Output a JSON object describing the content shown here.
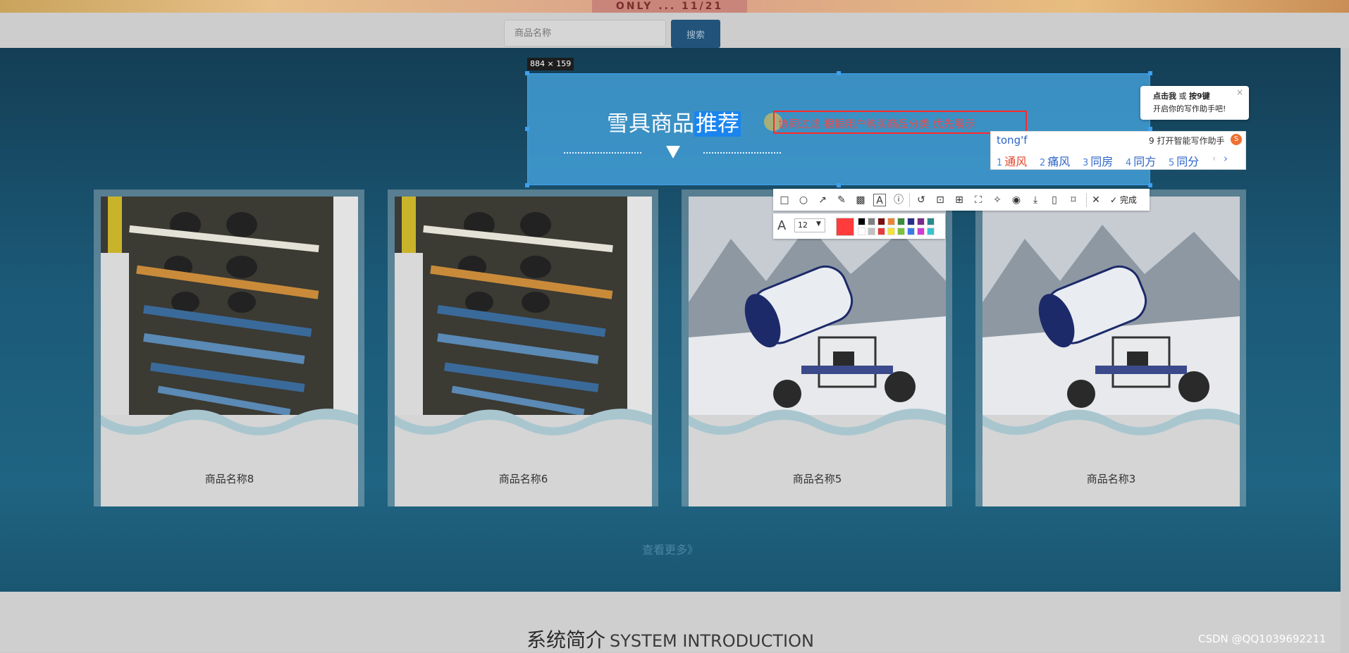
{
  "banner": {
    "text": "ONLY ... 11/21"
  },
  "search": {
    "placeholder": "商品名称",
    "button_label": "搜索"
  },
  "capture": {
    "size_label": "884 × 159",
    "title_prefix": "雪具商品",
    "title_highlight": "推荐",
    "annotation_text": "协同过滤 根据用户购买商品分类 优先展示"
  },
  "ime": {
    "tip_line1_a": "点击我",
    "tip_line1_b": " 或 ",
    "tip_line1_c": "按9键",
    "tip_line2": "开启你的写作助手吧!",
    "close": "×",
    "code": "tong'f",
    "assist": "9 打开智能写作助手",
    "candidates": [
      {
        "n": "1",
        "w": "通风"
      },
      {
        "n": "2",
        "w": "痛风"
      },
      {
        "n": "3",
        "w": "同房"
      },
      {
        "n": "4",
        "w": "同方"
      },
      {
        "n": "5",
        "w": "同分"
      }
    ],
    "prev": "‹",
    "next": "›"
  },
  "toolbar": {
    "tools": [
      "rectangle-icon",
      "ellipse-icon",
      "arrow-icon",
      "pencil-icon",
      "mosaic-icon",
      "text-icon",
      "number-icon",
      "undo-icon",
      "ocr-icon",
      "translate-icon",
      "pin-icon",
      "ai-icon",
      "record-icon",
      "download-icon",
      "save-mobile-icon",
      "bookmark-icon",
      "close-icon"
    ],
    "done_label": "完成",
    "font_size": "12",
    "current_color": "#ff3b3b",
    "palette_top": [
      "#000000",
      "#808080",
      "#7a1111",
      "#e8853a",
      "#3a8a3a",
      "#2c2c8c",
      "#7a2a8a",
      "#2a8a8a"
    ],
    "palette_bottom": [
      "#ffffff",
      "#c0c0c0",
      "#e83a3a",
      "#f2e23a",
      "#7ac23a",
      "#3a7ae8",
      "#d23ad2",
      "#3ac2d2"
    ]
  },
  "products": [
    {
      "name": "商品名称8",
      "image": "snowboard-rack"
    },
    {
      "name": "商品名称6",
      "image": "snowboard-rack"
    },
    {
      "name": "商品名称5",
      "image": "snow-cannon"
    },
    {
      "name": "商品名称3",
      "image": "snow-cannon"
    }
  ],
  "more_link": "查看更多》",
  "intro": {
    "title_cn": "系统简介",
    "title_en": "SYSTEM INTRODUCTION"
  },
  "watermark": "CSDN @QQ1039692211"
}
